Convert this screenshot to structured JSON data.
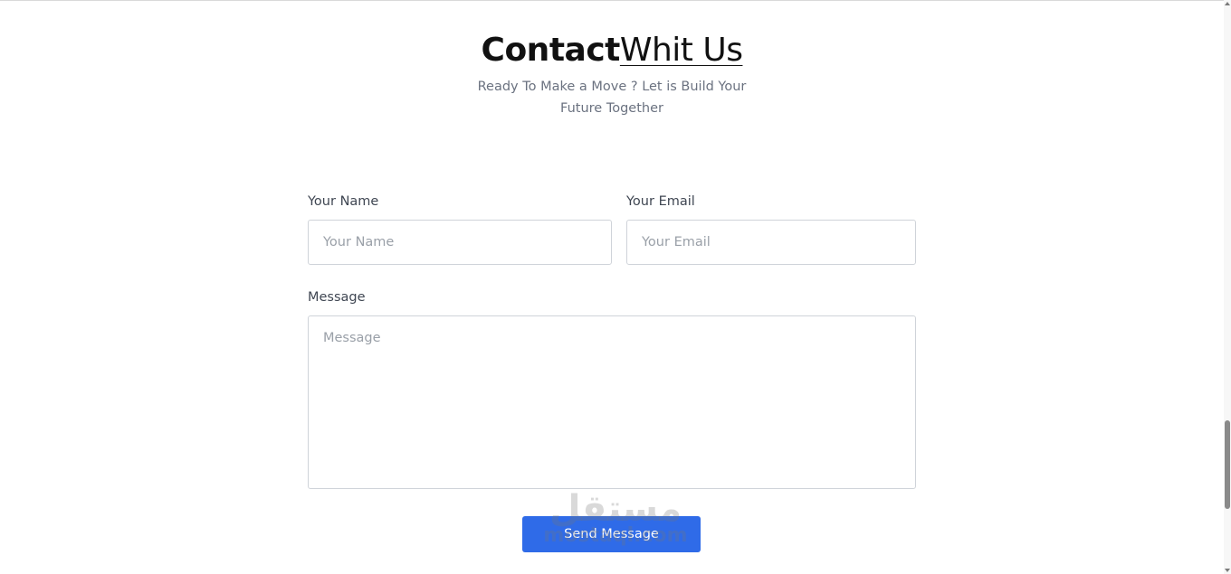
{
  "heading": {
    "bold": "Contact",
    "light": "Whit Us"
  },
  "subtitle": {
    "line1": "Ready To Make a Move ? Let is Build Your",
    "line2": "Future Together"
  },
  "form": {
    "name_label": "Your Name",
    "name_placeholder": "Your Name",
    "email_label": "Your Email",
    "email_placeholder": "Your Email",
    "message_label": "Message",
    "message_placeholder": "Message",
    "send_label": "Send Message"
  },
  "watermark": {
    "arabic": "مستقل",
    "latin": "mostaql.com"
  },
  "colors": {
    "accent": "#2f6be8",
    "label_text": "#3f4652",
    "subtitle_text": "#6b7280",
    "border": "#cfd3d9"
  }
}
